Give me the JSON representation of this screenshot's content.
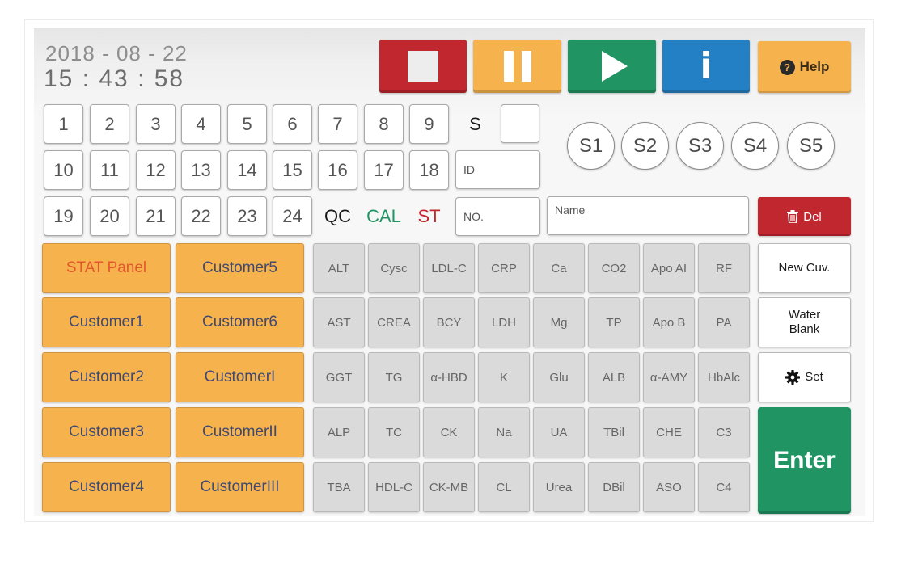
{
  "datetime": {
    "date": "2018 - 08 - 22",
    "time": "15 : 43 : 58"
  },
  "controls": {
    "stop_icon": "stop-icon",
    "pause_icon": "pause-icon",
    "play_icon": "play-icon",
    "info_glyph": "i",
    "help_label": "Help",
    "help_glyph": "?"
  },
  "colors": {
    "red": "#c0272e",
    "orange": "#f6b24d",
    "green": "#219464",
    "blue": "#2480c4",
    "cal": "#219464",
    "st": "#c0272e",
    "stat": "#e4572e"
  },
  "sample_keys": {
    "row1": [
      "1",
      "2",
      "3",
      "4",
      "5",
      "6",
      "7",
      "8",
      "9",
      "S"
    ],
    "row2": [
      "10",
      "11",
      "12",
      "13",
      "14",
      "15",
      "16",
      "17",
      "18"
    ],
    "row3": [
      "19",
      "20",
      "21",
      "22",
      "23",
      "24"
    ],
    "qc": "QC",
    "cal": "CAL",
    "st": "ST"
  },
  "fields": {
    "blank": "",
    "id_placeholder": "ID",
    "no_placeholder": "NO.",
    "name_placeholder": "Name"
  },
  "racks": [
    "S1",
    "S2",
    "S3",
    "S4",
    "S5"
  ],
  "actions": {
    "del": "Del",
    "new_cuv": "New Cuv.",
    "water_blank_1": "Water",
    "water_blank_2": "Blank",
    "set": "Set",
    "enter": "Enter"
  },
  "panels": {
    "left": [
      "STAT Panel",
      "Customer1",
      "Customer2",
      "Customer3",
      "Customer4"
    ],
    "right": [
      "Customer5",
      "Customer6",
      "CustomerI",
      "CustomerII",
      "CustomerIII"
    ]
  },
  "tests": [
    [
      "ALT",
      "Cysc",
      "LDL-C",
      "CRP",
      "Ca",
      "CO2",
      "Apo AI",
      "RF"
    ],
    [
      "AST",
      "CREA",
      "BCY",
      "LDH",
      "Mg",
      "TP",
      "Apo B",
      "PA"
    ],
    [
      "GGT",
      "TG",
      "α-HBD",
      "K",
      "Glu",
      "ALB",
      "α-AMY",
      "HbAlc"
    ],
    [
      "ALP",
      "TC",
      "CK",
      "Na",
      "UA",
      "TBil",
      "CHE",
      "C3"
    ],
    [
      "TBA",
      "HDL-C",
      "CK-MB",
      "CL",
      "Urea",
      "DBil",
      "ASO",
      "C4"
    ]
  ]
}
